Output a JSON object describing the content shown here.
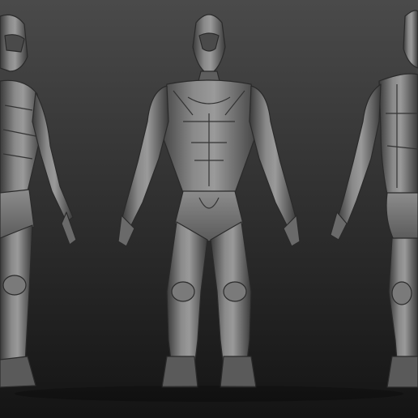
{
  "scene": {
    "background_top": "#4a4a4a",
    "background_bottom": "#141414",
    "material_light": "#9a9a9a",
    "material_mid": "#6e6e6e",
    "material_dark": "#2c2c2c",
    "views": [
      {
        "id": "three-quarter",
        "name": "three-quarter-view"
      },
      {
        "id": "front",
        "name": "front-view"
      },
      {
        "id": "back",
        "name": "back-view"
      }
    ]
  }
}
